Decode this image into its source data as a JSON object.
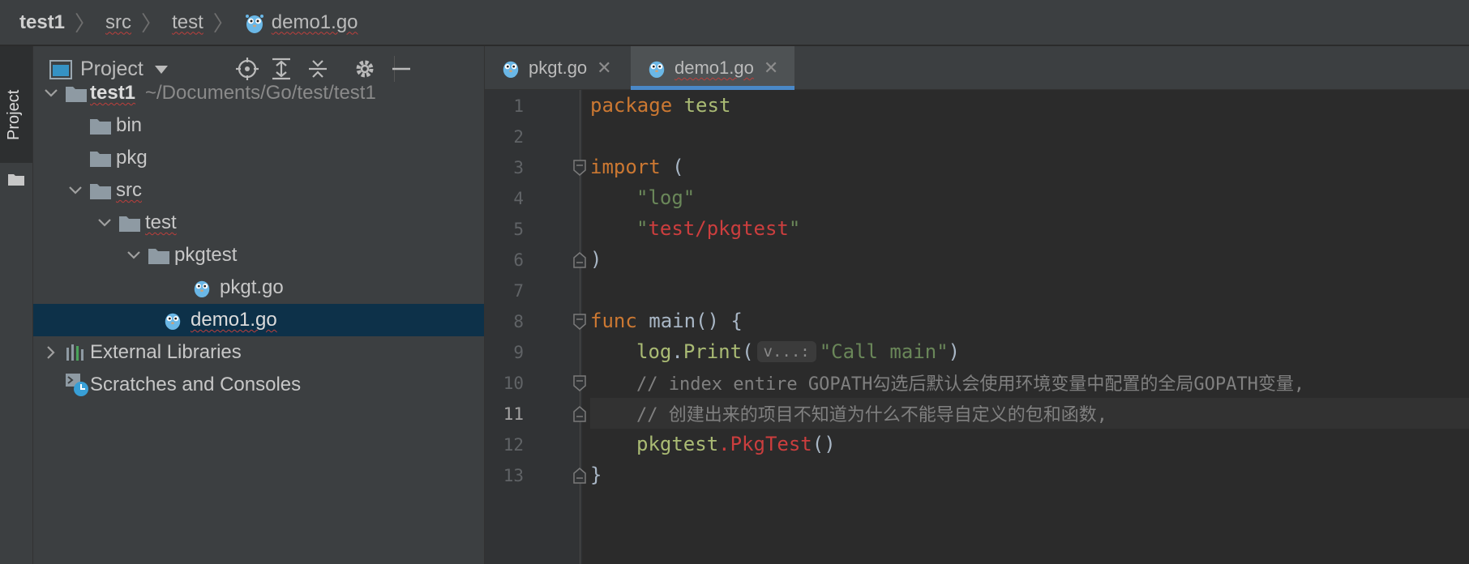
{
  "breadcrumb": {
    "items": [
      "test1",
      "src",
      "test",
      "demo1.go"
    ],
    "separator": "〉"
  },
  "tool_strip": {
    "project_label": "Project"
  },
  "project_panel": {
    "title": "Project",
    "tree": [
      {
        "label": "test1",
        "suffix": "~/Documents/Go/test/test1",
        "type": "folder",
        "expanded": true
      },
      {
        "label": "bin",
        "type": "folder"
      },
      {
        "label": "pkg",
        "type": "folder"
      },
      {
        "label": "src",
        "type": "folder",
        "expanded": true
      },
      {
        "label": "test",
        "type": "folder",
        "expanded": true
      },
      {
        "label": "pkgtest",
        "type": "folder",
        "expanded": true
      },
      {
        "label": "pkgt.go",
        "type": "go-file"
      },
      {
        "label": "demo1.go",
        "type": "go-file",
        "selected": true
      },
      {
        "label": "External Libraries",
        "type": "libraries",
        "expanded": false
      },
      {
        "label": "Scratches and Consoles",
        "type": "scratches"
      }
    ]
  },
  "editor": {
    "tabs": [
      {
        "label": "pkgt.go",
        "active": false
      },
      {
        "label": "demo1.go",
        "active": true
      }
    ],
    "line_numbers": [
      "1",
      "2",
      "3",
      "4",
      "5",
      "6",
      "7",
      "8",
      "9",
      "10",
      "11",
      "12",
      "13"
    ],
    "current_line": "11",
    "code": {
      "l1_kw": "package",
      "l1_name": " test",
      "l3_kw": "import",
      "l3_rest": " (",
      "l4_str": "\"log\"",
      "l5_q1": "\"",
      "l5_path": "test/pkgtest",
      "l5_q2": "\"",
      "l6_close": ")",
      "l8_kw": "func",
      "l8_name": " main",
      "l8_rest": "() {",
      "l9_pkg": "log",
      "l9_dot": ".",
      "l9_fn": "Print",
      "l9_open": "(",
      "l9_hint": "v...:",
      "l9_str": "\"Call main\"",
      "l9_close": ")",
      "l10_comment": "// index entire GOPATH勾选后默认会使用环境变量中配置的全局GOPATH变量,",
      "l11_comment": "// 创建出来的项目不知道为什么不能导自定义的包和函数,",
      "l12_pkg": "pkgtest",
      "l12_dot": ".",
      "l12_fn": "PkgTest",
      "l12_rest": "()",
      "l13_close": "}"
    }
  },
  "colors": {
    "keyword": "#cc7832",
    "string": "#6a8759",
    "error": "#cc3e3e",
    "comment": "#808080",
    "selection": "#0d3149",
    "tab_underline": "#4a88c7"
  }
}
